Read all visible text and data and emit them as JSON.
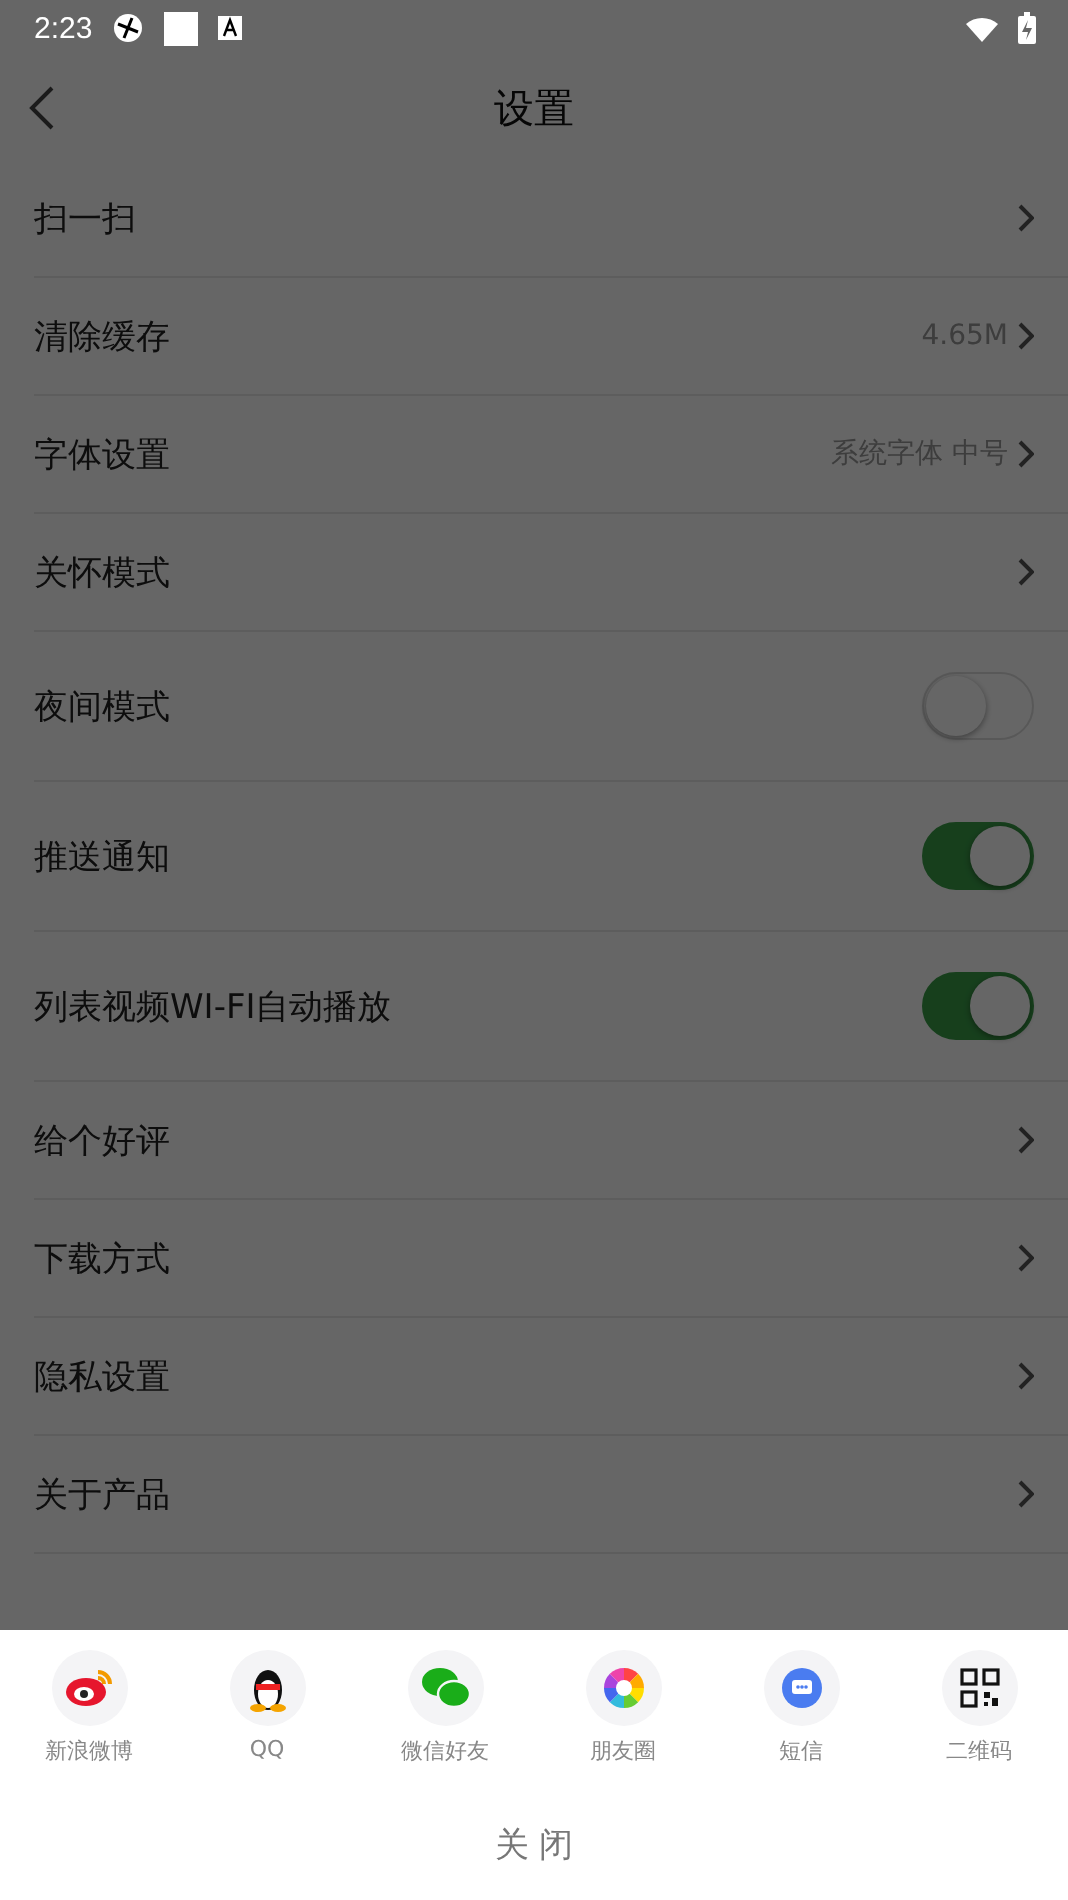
{
  "status_bar": {
    "time": "2:23"
  },
  "header": {
    "title": "设置"
  },
  "settings": [
    {
      "kind": "link",
      "label": "扫一扫"
    },
    {
      "kind": "link",
      "label": "清除缓存",
      "value": "4.65M"
    },
    {
      "kind": "link",
      "label": "字体设置",
      "value": "系统字体 中号"
    },
    {
      "kind": "link",
      "label": "关怀模式"
    },
    {
      "kind": "toggle",
      "label": "夜间模式",
      "on": false
    },
    {
      "kind": "toggle",
      "label": "推送通知",
      "on": true
    },
    {
      "kind": "toggle",
      "label": "列表视频WI-FI自动播放",
      "on": true
    },
    {
      "kind": "link",
      "label": "给个好评"
    },
    {
      "kind": "link",
      "label": "下载方式"
    },
    {
      "kind": "link",
      "label": "隐私设置"
    },
    {
      "kind": "link",
      "label": "关于产品"
    }
  ],
  "share_sheet": {
    "targets": [
      {
        "kind": "weibo",
        "label": "新浪微博"
      },
      {
        "kind": "qq",
        "label": "QQ"
      },
      {
        "kind": "wechat",
        "label": "微信好友"
      },
      {
        "kind": "moments",
        "label": "朋友圈"
      },
      {
        "kind": "sms",
        "label": "短信"
      },
      {
        "kind": "qrcode",
        "label": "二维码"
      }
    ],
    "close": "关 闭"
  }
}
